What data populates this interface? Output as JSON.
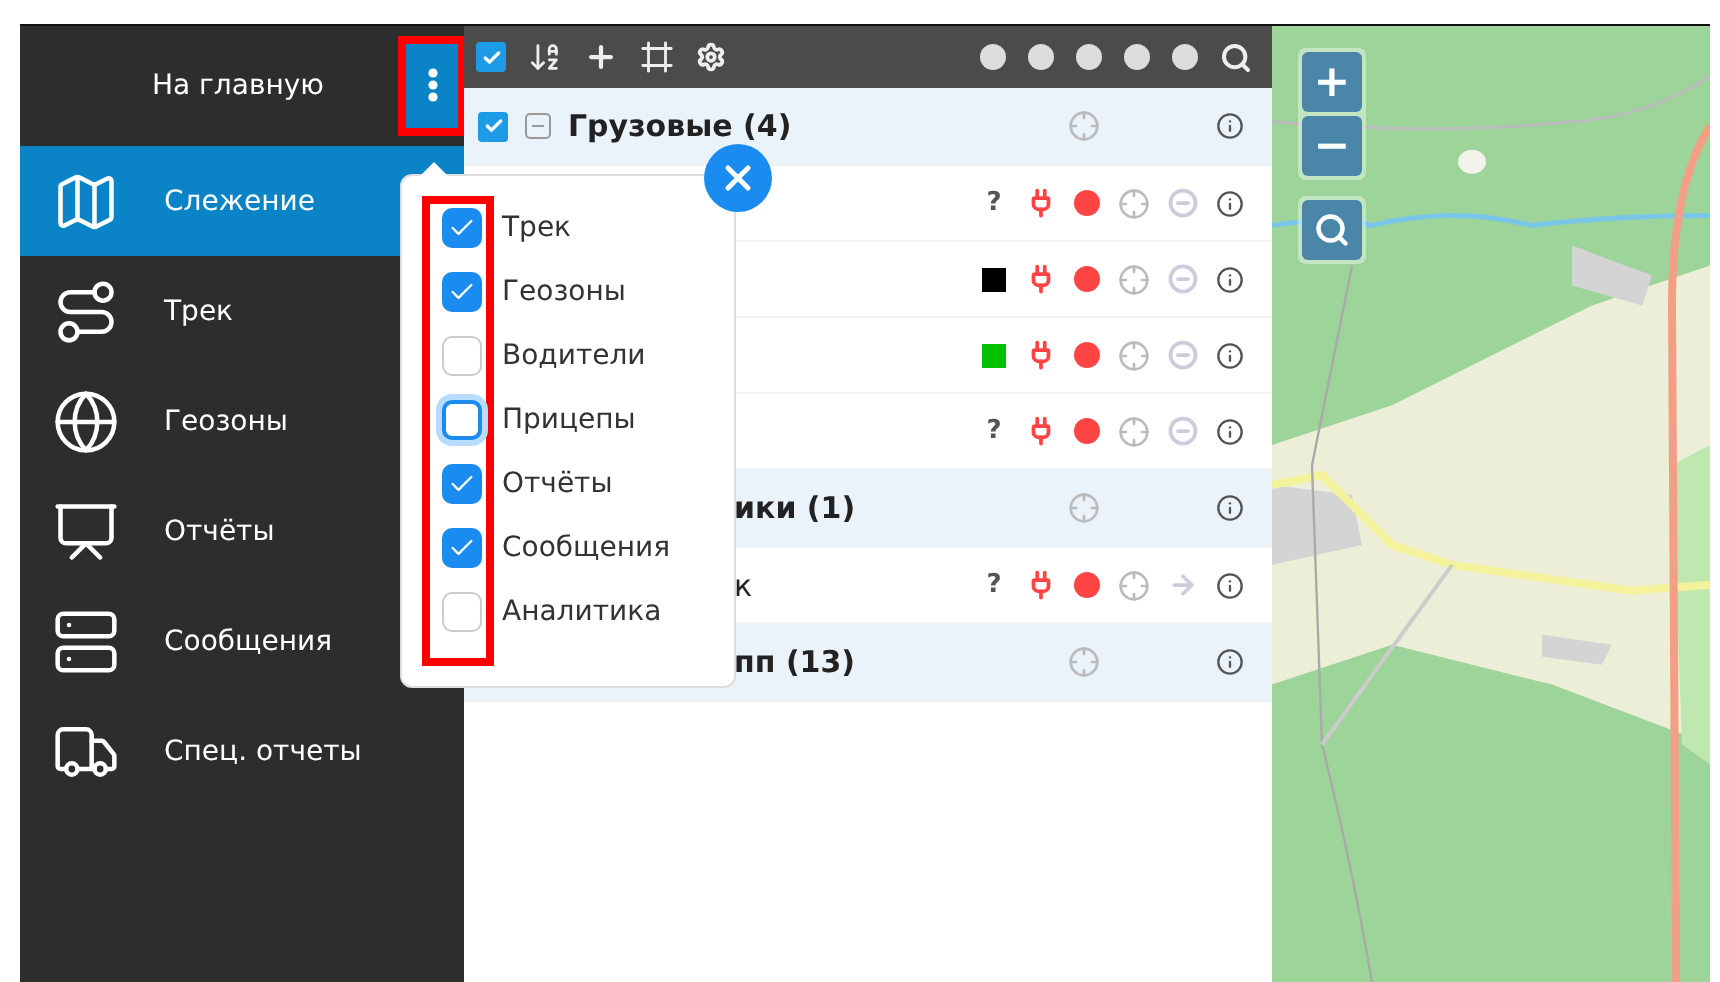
{
  "sidebar": {
    "home": "На главную",
    "items": [
      {
        "label": "Слежение",
        "selected": true
      },
      {
        "label": "Трек",
        "selected": false
      },
      {
        "label": "Геозоны",
        "selected": false
      },
      {
        "label": "Отчёты",
        "selected": false
      },
      {
        "label": "Сообщения",
        "selected": false
      },
      {
        "label": "Спец. отчеты",
        "selected": false
      }
    ]
  },
  "toolbar": {
    "checked": true
  },
  "rows": [
    {
      "kind": "group",
      "name": "Грузовые (4)",
      "checked": true
    },
    {
      "kind": "unit",
      "mark": "?"
    },
    {
      "kind": "unit",
      "color": "#000000"
    },
    {
      "kind": "unit",
      "color": "#00c000"
    },
    {
      "kind": "unit",
      "mark": "?"
    },
    {
      "kind": "group",
      "name": "ики (1)"
    },
    {
      "kind": "unit-arrow",
      "name": "к",
      "mark": "?"
    },
    {
      "kind": "group",
      "name": "пп (13)"
    }
  ],
  "menu": {
    "items": [
      {
        "label": "Трек",
        "checked": true,
        "focused": false
      },
      {
        "label": "Геозоны",
        "checked": true,
        "focused": false
      },
      {
        "label": "Водители",
        "checked": false,
        "focused": false
      },
      {
        "label": "Прицепы",
        "checked": false,
        "focused": true
      },
      {
        "label": "Отчёты",
        "checked": true,
        "focused": false
      },
      {
        "label": "Сообщения",
        "checked": true,
        "focused": false
      },
      {
        "label": "Аналитика",
        "checked": false,
        "focused": false
      }
    ]
  },
  "map": {
    "controls": [
      "+",
      "−"
    ]
  }
}
